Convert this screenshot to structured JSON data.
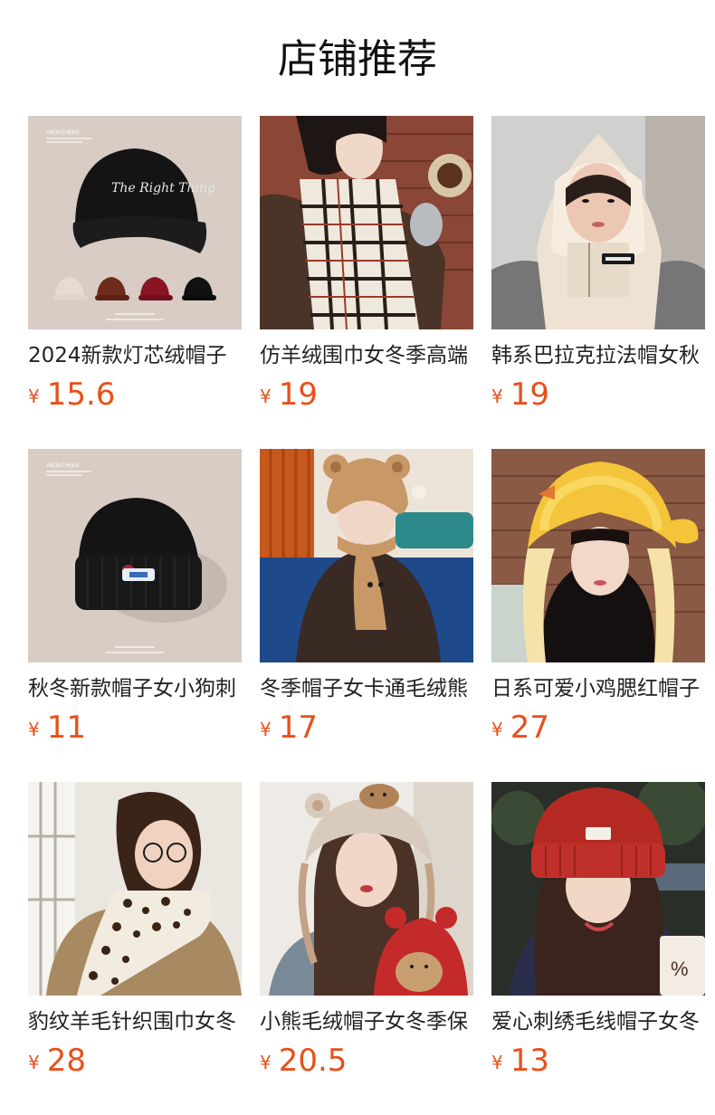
{
  "header": {
    "title": "店铺推荐"
  },
  "currency_symbol": "¥",
  "products": [
    {
      "name": "2024新款灯芯绒帽子",
      "price": "15.6",
      "image": "black-cap-product-photo",
      "brand_text": "ABOUTHEKK",
      "cap_text": "The Right Thing"
    },
    {
      "name": "仿羊绒围巾女冬季高端",
      "price": "19",
      "image": "plaid-scarf-model-photo"
    },
    {
      "name": "韩系巴拉克拉法帽女秋",
      "price": "19",
      "image": "balaclava-model-photo"
    },
    {
      "name": "秋冬新款帽子女小狗刺",
      "price": "11",
      "image": "black-beanie-product-photo",
      "brand_text": "ABOUTHEKK"
    },
    {
      "name": "冬季帽子女卡通毛绒熊",
      "price": "17",
      "image": "bear-hat-scarf-model-photo"
    },
    {
      "name": "日系可爱小鸡腮红帽子",
      "price": "27",
      "image": "chick-hat-model-photo"
    },
    {
      "name": "豹纹羊毛针织围巾女冬",
      "price": "28",
      "image": "leopard-scarf-model-photo"
    },
    {
      "name": "小熊毛绒帽子女冬季保",
      "price": "20.5",
      "image": "bear-ear-hat-model-photo"
    },
    {
      "name": "爱心刺绣毛线帽子女冬",
      "price": "13",
      "image": "red-beanie-model-photo"
    }
  ]
}
